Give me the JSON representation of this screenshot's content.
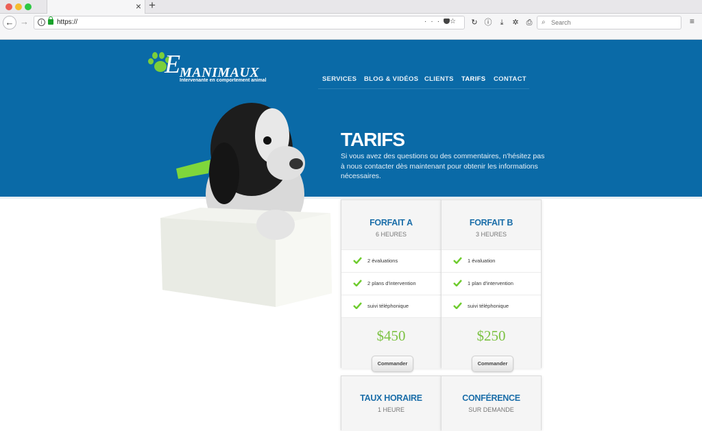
{
  "browser": {
    "tab_close": "×",
    "new_tab": "+",
    "back": "←",
    "forward": "→",
    "url": "https://",
    "url_actions": [
      "···",
      "pocket",
      "☆"
    ],
    "toolbar_icons": [
      "reload",
      "info",
      "download",
      "settings",
      "print"
    ],
    "search_placeholder": "Search",
    "menu": "≡",
    "traffic_lights": {
      "close": "#ec5f56",
      "minimize": "#f5bd30",
      "maximize": "#2ec844"
    }
  },
  "site": {
    "brand_color": "#0a6aa7",
    "accent_green": "#7cc243",
    "logo": {
      "initial": "E",
      "name": "MANIMAUX",
      "tagline": "Intervenante en comportement animal"
    },
    "nav": [
      {
        "label": "SERVICES",
        "active": false
      },
      {
        "label": "BLOG & VIDÉOS",
        "active": false
      },
      {
        "label": "CLIENTS",
        "active": false
      },
      {
        "label": "TARIFS",
        "active": true
      },
      {
        "label": "CONTACT",
        "active": false
      }
    ],
    "hero": {
      "title": "TARIFS",
      "intro": "Si vous avez des questions ou des commentaires, n'hésitez pas à nous contacter dès maintenant pour obtenir les informations nécessaires."
    },
    "plans": [
      {
        "title": "FORFAIT A",
        "subtitle": "6 HEURES",
        "features": [
          "2 évaluations",
          "2 plans d'intervention",
          "suivi téléphonique"
        ],
        "price": "$450",
        "button": "Commander"
      },
      {
        "title": "FORFAIT B",
        "subtitle": "3 HEURES",
        "features": [
          "1 évaluation",
          "1 plan d'intervention",
          "suivi téléphonique"
        ],
        "price": "$250",
        "button": "Commander"
      },
      {
        "title": "TAUX HORAIRE",
        "subtitle": "1 HEURE"
      },
      {
        "title": "CONFÉRENCE",
        "subtitle": "SUR DEMANDE"
      }
    ]
  }
}
